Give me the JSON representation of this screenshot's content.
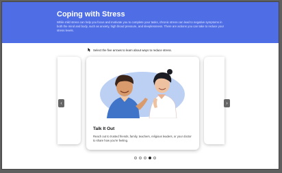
{
  "header": {
    "title": "Coping with Stress",
    "intro": "While mild stress can help you focus and motivate you to complete your tasks, chronic stress can lead to negative symptoms in both the mind and body, such as anxiety, high blood pressure, and sleeplessness. There are actions you can take to reduce your stress levels."
  },
  "instruction": {
    "text": "Select the five arrows to learn about ways to reduce stress.",
    "icon": "cursor-pointer-icon"
  },
  "carousel": {
    "prev_icon": "chevron-left-icon",
    "next_icon": "chevron-right-icon",
    "prev_glyph": "‹",
    "next_glyph": "›",
    "card": {
      "title": "Talk It Out",
      "text": "Reach out to trusted friends, family, teachers, religious leaders, or your doctor to share how you're feeling.",
      "illustration": "two-people-talking-illustration"
    },
    "total_slides": 5,
    "active_index": 3
  },
  "colors": {
    "header_bg": "#4f6ee6",
    "illustration_bg": "#bcd0f4",
    "shirt_blue": "#3f74c9",
    "active_dot": "#222222"
  }
}
